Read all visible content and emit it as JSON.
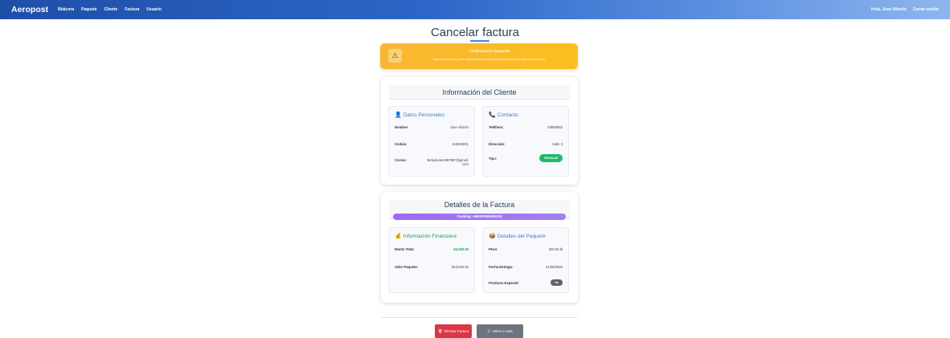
{
  "navbar": {
    "brand": "Aeropost",
    "links": [
      "Bitácora",
      "Paquete",
      "Cliente",
      "Factura",
      "Usuario"
    ],
    "greeting": "Hola, Jose Alberto",
    "logout": "Cerrar sesión",
    "gradient_colors": [
      "#1e4fa8",
      "#8fb6ee"
    ]
  },
  "page": {
    "title": "Cancelar factura"
  },
  "warning": {
    "icon": "warning-triangle-icon",
    "title": "Confirmación requerida",
    "text": "Esta acción no se puede deshacer y eliminará permanentemente la factura del sistema."
  },
  "client": {
    "header": "Información del Cliente",
    "personal": {
      "title": "Datos Personales",
      "icon": "user-icon",
      "rows": [
        {
          "label": "Nombre:",
          "value": "Jose Alberto"
        },
        {
          "label": "Cedula:",
          "value": "118250001"
        },
        {
          "label": "Correo:",
          "value_line1": "Betoalvarez987987@gmail.",
          "value_line2": "com"
        }
      ]
    },
    "contact": {
      "title": "Contacto",
      "icon": "phone-icon",
      "rows": [
        {
          "label": "Teléfono:",
          "value": "83850962"
        },
        {
          "label": "Dirección:",
          "value": "Calle 3"
        },
        {
          "label": "Tipo:",
          "badge": "REGULAR"
        }
      ]
    }
  },
  "invoice": {
    "header": "Detalles de la Factura",
    "tracking": "Tracking: AM0020985434034",
    "financial": {
      "title": "Información Financiera",
      "icon": "money-bag-icon",
      "rows": [
        {
          "label": "Monto Total:",
          "value": "$4,300.00"
        },
        {
          "label": "Valor Paquete:",
          "value": "$10,000.00"
        }
      ]
    },
    "package": {
      "title": "Detalles del Paquete",
      "icon": "package-icon",
      "rows": [
        {
          "label": "Peso:",
          "value": "250.00 lb"
        },
        {
          "label": "Fecha Entrega:",
          "value": "21/08/2025"
        },
        {
          "label": "Producto Especial:",
          "badge": "No"
        }
      ]
    }
  },
  "actions": {
    "delete_label": "Eliminar Factura",
    "back_label": "Volver a Lista"
  },
  "colors": {
    "accent": "#3a7bd5",
    "warning": "#fbbf1f",
    "success": "#20b86a",
    "money": "#1f9d55",
    "danger": "#dc3545",
    "secondary": "#6c757d",
    "tracking": "#9b6cf0"
  }
}
